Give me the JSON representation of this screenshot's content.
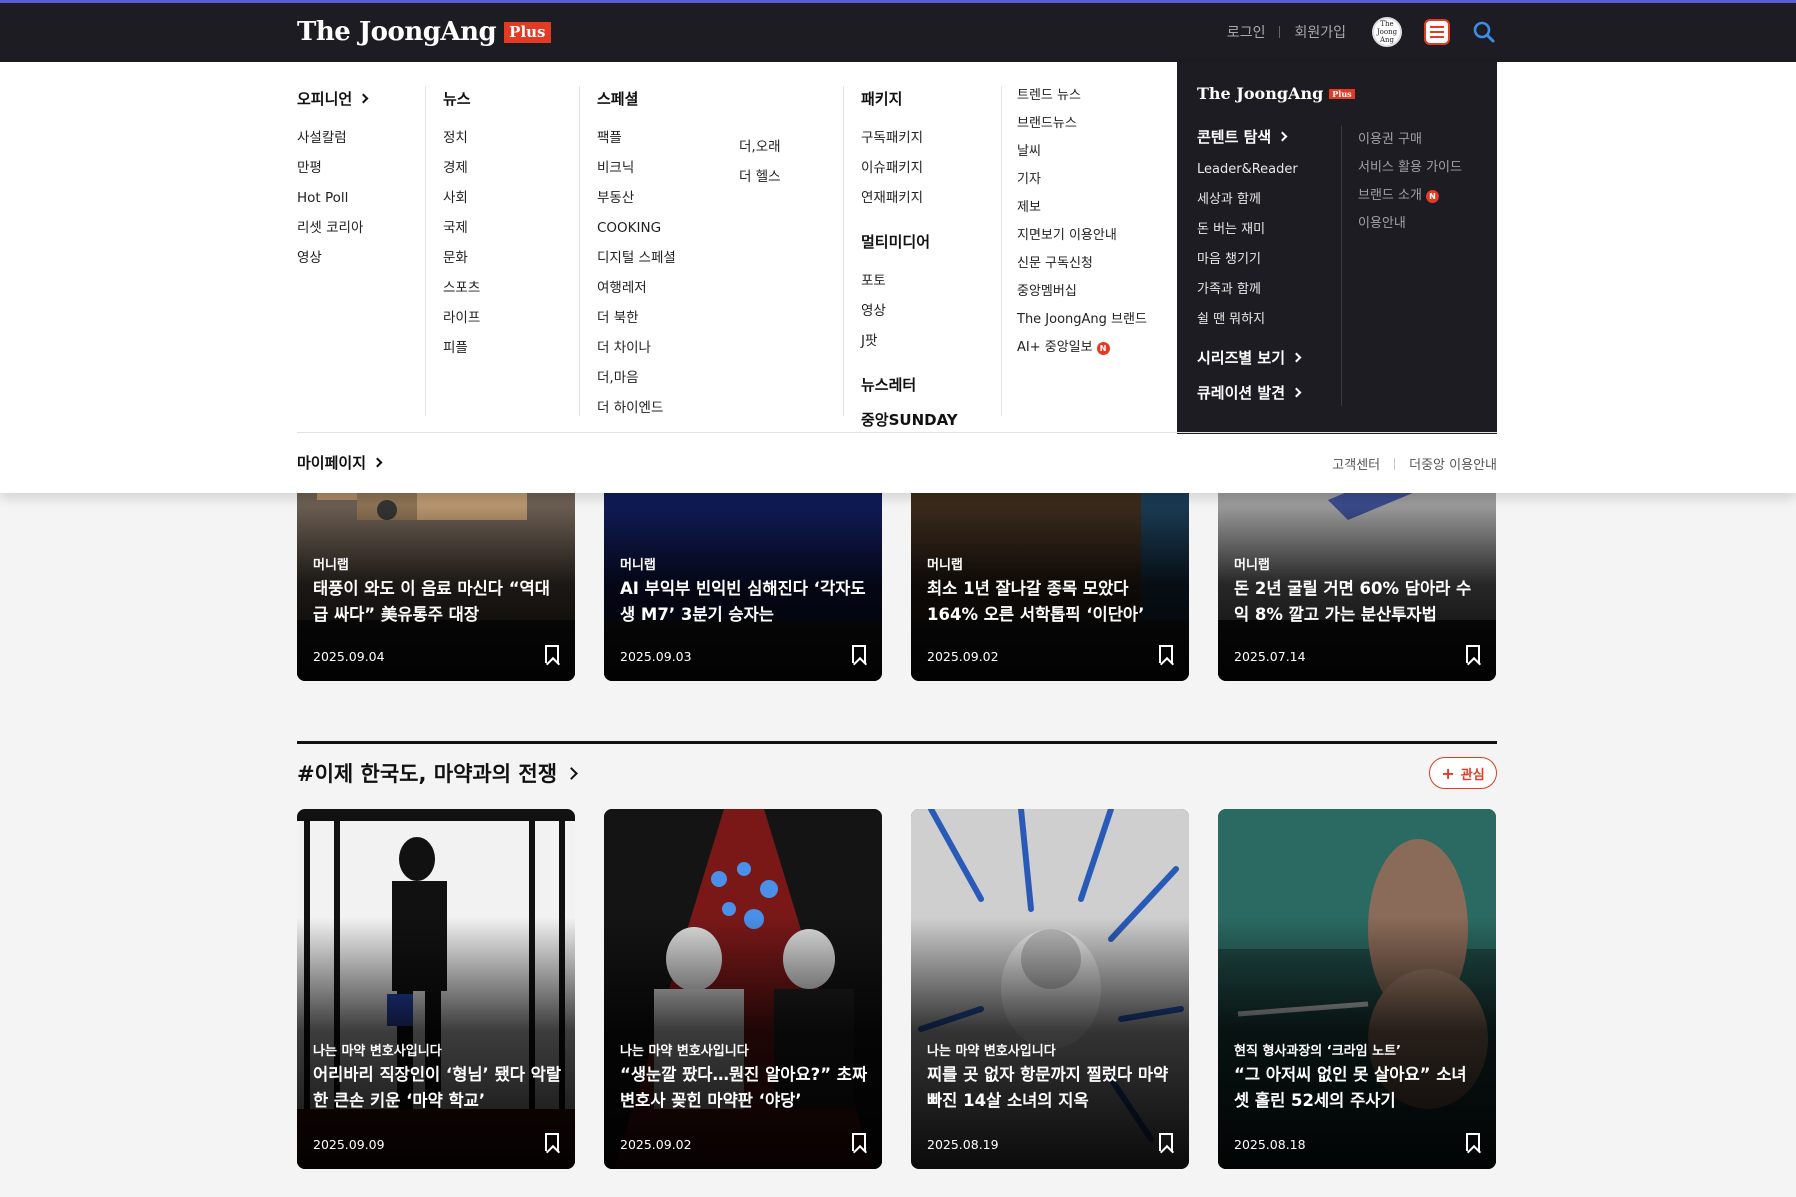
{
  "header": {
    "logo_text": "The JoongAng",
    "logo_plus": "Plus",
    "login": "로그인",
    "signup": "회원가입",
    "avatar_text": "The Joong Ang"
  },
  "menu": {
    "opinion": {
      "label": "오피니언",
      "items": [
        "사설칼럼",
        "만평",
        "Hot Poll",
        "리셋 코리아",
        "영상"
      ]
    },
    "news": {
      "label": "뉴스",
      "items": [
        "정치",
        "경제",
        "사회",
        "국제",
        "문화",
        "스포츠",
        "라이프",
        "피플"
      ]
    },
    "special": {
      "label": "스페셜",
      "items_a": [
        "팩플",
        "비크닉",
        "부동산",
        "COOKING",
        "디지털 스페셜",
        "여행레저",
        "더 북한",
        "더 차이나",
        "더,마음",
        "더 하이엔드"
      ],
      "items_b": [
        "더,오래",
        "더 헬스"
      ]
    },
    "package": {
      "label": "패키지",
      "items": [
        "구독패키지",
        "이슈패키지",
        "연재패키지"
      ]
    },
    "multimedia": {
      "label": "멀티미디어",
      "items": [
        "포토",
        "영상",
        "J팟"
      ]
    },
    "newsletter": "뉴스레터",
    "sunday": "중앙SUNDAY",
    "misc": {
      "items": [
        "트렌드 뉴스",
        "브랜드뉴스",
        "날씨",
        "기자",
        "제보",
        "지면보기 이용안내",
        "신문 구독신청",
        "중앙멤버십",
        "The JoongAng 브랜드",
        "AI+ 중앙일보"
      ],
      "badge": "N"
    },
    "panel": {
      "logo_text": "The JoongAng",
      "logo_plus": "Plus",
      "explore": "콘텐트 탐색",
      "explore_items": [
        "Leader&Reader",
        "세상과 함께",
        "돈 버는 재미",
        "마음 챙기기",
        "가족과 함께",
        "쉴 땐 뭐하지"
      ],
      "series": "시리즈별 보기",
      "curation": "큐레이션 발견",
      "right_items": [
        "이용권 구매",
        "서비스 활용 가이드",
        "브랜드 소개",
        "이용안내"
      ],
      "badge": "N"
    },
    "mypage": "마이페이지",
    "customer_center": "고객센터",
    "service_guide": "더중앙 이용안내"
  },
  "cards_row1": [
    {
      "category": "머니랩",
      "title": "태풍이 와도 이 음료 마신다 “역대급 싸다” 美유통주 대장",
      "date": "2025.09.04"
    },
    {
      "category": "머니랩",
      "title": "AI 부익부 빈익빈 심해진다 ‘각자도생 M7’ 3분기 승자는",
      "date": "2025.09.03"
    },
    {
      "category": "머니랩",
      "title": "최소 1년 잘나갈 종목 모았다 164% 오른 서학톱픽 ‘이단아’",
      "date": "2025.09.02"
    },
    {
      "category": "머니랩",
      "title": "돈 2년 굴릴 거면 60% 담아라 수익 8% 깔고 가는 분산투자법",
      "date": "2025.07.14"
    }
  ],
  "section": {
    "title": "#이제 한국도, 마약과의 전쟁",
    "interest_label": "관심",
    "plus": "+"
  },
  "cards_row2": [
    {
      "category": "나는 마약 변호사입니다",
      "title": "어리바리 직장인이 ‘형님’ 됐다 악랄한 큰손 키운 ‘마약 학교’",
      "date": "2025.09.09"
    },
    {
      "category": "나는 마약 변호사입니다",
      "title": "“생눈깔 팠다…뭔진 알아요?” 초짜 변호사 꽂힌 마약판 ‘야당’",
      "date": "2025.09.02"
    },
    {
      "category": "나는 마약 변호사입니다",
      "title": "찌를 곳 없자 항문까지 찔렀다 마약 빠진 14살 소녀의 지옥",
      "date": "2025.08.19"
    },
    {
      "category": "현직 형사과장의 ‘크라임 노트’",
      "title": "“그 아저씨 없인 못 살아요” 소녀 셋 홀린 52세의 주사기",
      "date": "2025.08.18"
    }
  ],
  "colors": {
    "accent": "#e33b23",
    "dark": "#1c1c22"
  },
  "icons": [
    "chevron-right-icon",
    "menu-icon",
    "search-icon",
    "bookmark-icon",
    "plus-icon",
    "new-badge-icon"
  ]
}
